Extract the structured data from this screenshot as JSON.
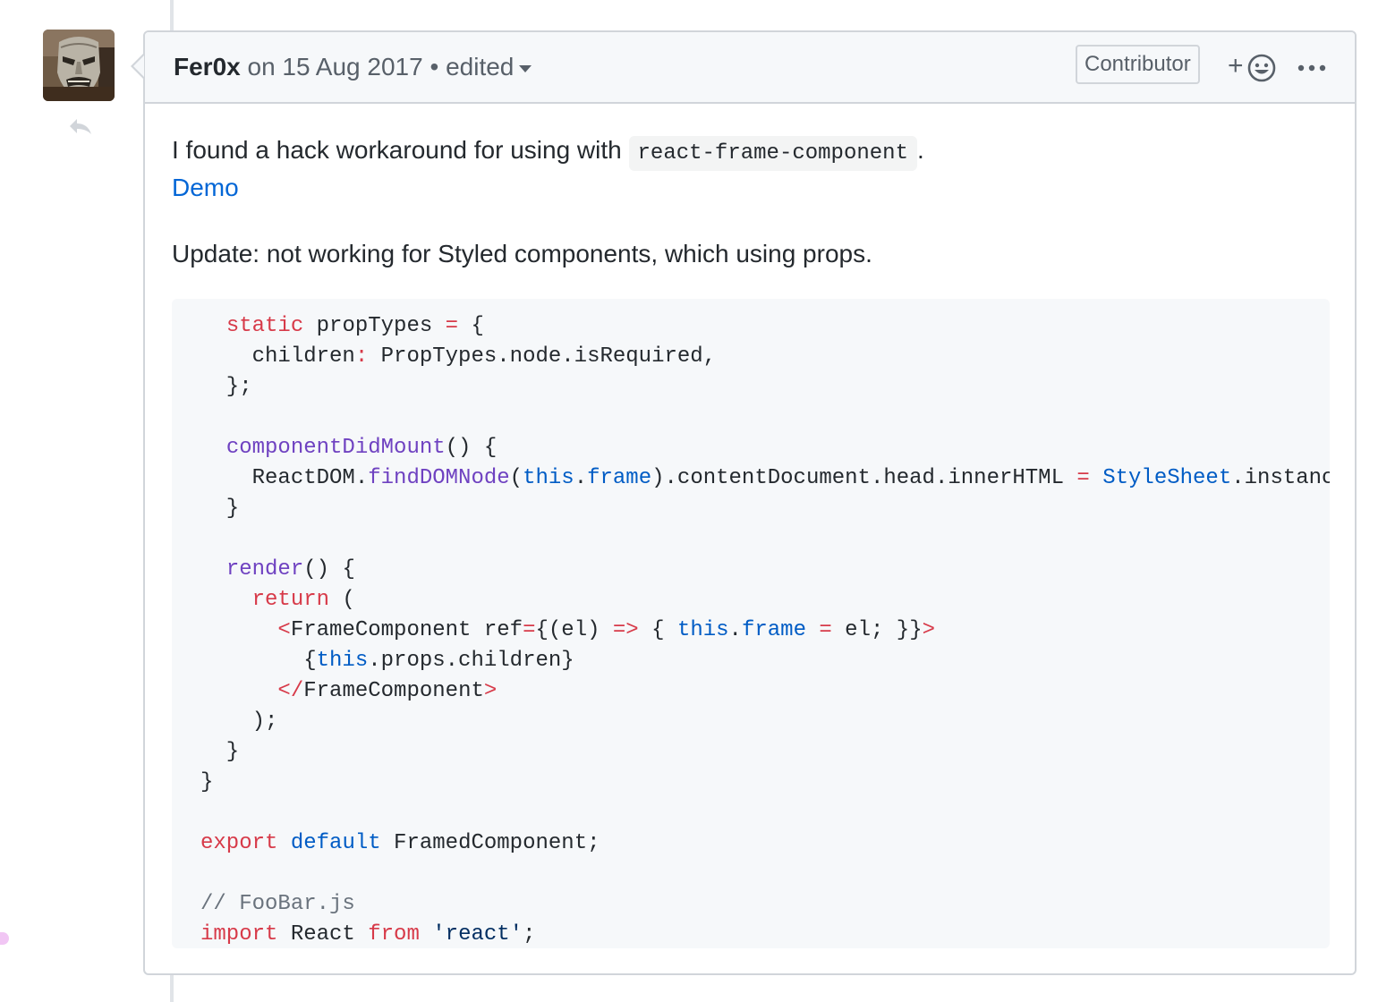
{
  "comment": {
    "author": "Fer0x",
    "date_text": "on 15 Aug 2017",
    "separator": "•",
    "edited_label": "edited",
    "badge": "Contributor",
    "reaction_plus": "+",
    "icons": {
      "avatar": "user-avatar",
      "reply": "reply-icon",
      "edited_dropdown": "chevron-down-icon",
      "reaction": "smiley-icon",
      "more": "kebab-horizontal-icon"
    }
  },
  "body": {
    "intro_text": "I found a hack workaround for using with",
    "intro_code": "react-frame-component",
    "intro_period": ".",
    "demo_link": "Demo",
    "update_text": "Update: not working for Styled components, which using props."
  },
  "code": {
    "lines": [
      [
        {
          "t": "  "
        },
        {
          "t": "static",
          "c": "kw"
        },
        {
          "t": " propTypes "
        },
        {
          "t": "=",
          "c": "kw"
        },
        {
          "t": " {"
        }
      ],
      [
        {
          "t": "    children"
        },
        {
          "t": ":",
          "c": "kw"
        },
        {
          "t": " PropTypes.node.isRequired,"
        }
      ],
      [
        {
          "t": "  };"
        }
      ],
      [
        {
          "t": ""
        }
      ],
      [
        {
          "t": "  "
        },
        {
          "t": "componentDidMount",
          "c": "fn"
        },
        {
          "t": "() {"
        }
      ],
      [
        {
          "t": "    ReactDOM."
        },
        {
          "t": "findDOMNode",
          "c": "fn"
        },
        {
          "t": "("
        },
        {
          "t": "this",
          "c": "cn"
        },
        {
          "t": "."
        },
        {
          "t": "frame",
          "c": "cn"
        },
        {
          "t": ").contentDocument.head.innerHTML "
        },
        {
          "t": "=",
          "c": "kw"
        },
        {
          "t": " "
        },
        {
          "t": "StyleSheet",
          "c": "cn"
        },
        {
          "t": ".instanc"
        }
      ],
      [
        {
          "t": "  }"
        }
      ],
      [
        {
          "t": ""
        }
      ],
      [
        {
          "t": "  "
        },
        {
          "t": "render",
          "c": "fn"
        },
        {
          "t": "() {"
        }
      ],
      [
        {
          "t": "    "
        },
        {
          "t": "return",
          "c": "kw"
        },
        {
          "t": " ("
        }
      ],
      [
        {
          "t": "      "
        },
        {
          "t": "<",
          "c": "kw"
        },
        {
          "t": "FrameComponent ref"
        },
        {
          "t": "=",
          "c": "kw"
        },
        {
          "t": "{(el) "
        },
        {
          "t": "=>",
          "c": "kw"
        },
        {
          "t": " { "
        },
        {
          "t": "this",
          "c": "cn"
        },
        {
          "t": "."
        },
        {
          "t": "frame",
          "c": "cn"
        },
        {
          "t": " "
        },
        {
          "t": "=",
          "c": "kw"
        },
        {
          "t": " el; }}"
        },
        {
          "t": ">",
          "c": "kw"
        }
      ],
      [
        {
          "t": "        {"
        },
        {
          "t": "this",
          "c": "cn"
        },
        {
          "t": ".props.children}"
        }
      ],
      [
        {
          "t": "      "
        },
        {
          "t": "</",
          "c": "kw"
        },
        {
          "t": "FrameComponent"
        },
        {
          "t": ">",
          "c": "kw"
        }
      ],
      [
        {
          "t": "    );"
        }
      ],
      [
        {
          "t": "  }"
        }
      ],
      [
        {
          "t": "}"
        }
      ],
      [
        {
          "t": ""
        }
      ],
      [
        {
          "t": "export",
          "c": "kw"
        },
        {
          "t": " "
        },
        {
          "t": "default",
          "c": "cn"
        },
        {
          "t": " FramedComponent;"
        }
      ],
      [
        {
          "t": ""
        }
      ],
      [
        {
          "t": "// FooBar.js",
          "c": "cm"
        }
      ],
      [
        {
          "t": "import",
          "c": "kw"
        },
        {
          "t": " React "
        },
        {
          "t": "from",
          "c": "kw"
        },
        {
          "t": " "
        },
        {
          "t": "'react'",
          "c": "st"
        },
        {
          "t": ";"
        }
      ]
    ]
  }
}
